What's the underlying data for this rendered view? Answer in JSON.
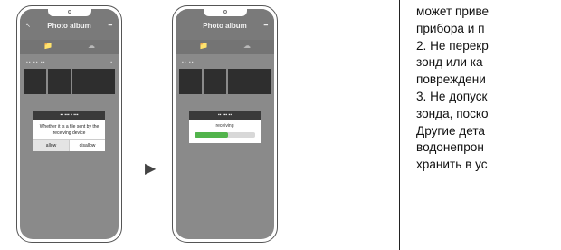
{
  "phone1": {
    "title": "Photo album",
    "back_icon": "back-arrow-icon",
    "menu_icon": "menu-icon",
    "tabs": [
      "folder-icon",
      "cloud-icon"
    ],
    "row_label": "▪▪ ▪▪ ▪▪",
    "row_tick": "▪",
    "dialog": {
      "header": "▪▪ ▪▪▪ ▪ ▪▪▪",
      "message": "Whether it is a file sent by the receiving device",
      "allow": "allow",
      "disallow": "disallow"
    }
  },
  "phone2": {
    "title": "Photo album",
    "menu_icon": "menu-icon",
    "tabs": [
      "folder-icon",
      "cloud-icon"
    ],
    "row_label": "▪▪ ▪▪",
    "dialog": {
      "header": "▪▪ ▪▪▪ ▪▪",
      "label": "receiving",
      "progress": 0.55,
      "progress_color": "#52b44c"
    }
  },
  "arrow": "▶",
  "text_lines": [
    "может приве",
    "прибора и п",
    "2. Не перекр",
    "зонд или ка",
    "повреждени",
    "3. Не допуск",
    "зонда, поско",
    "Другие дета",
    "водонепрон",
    "хранить в ус"
  ]
}
